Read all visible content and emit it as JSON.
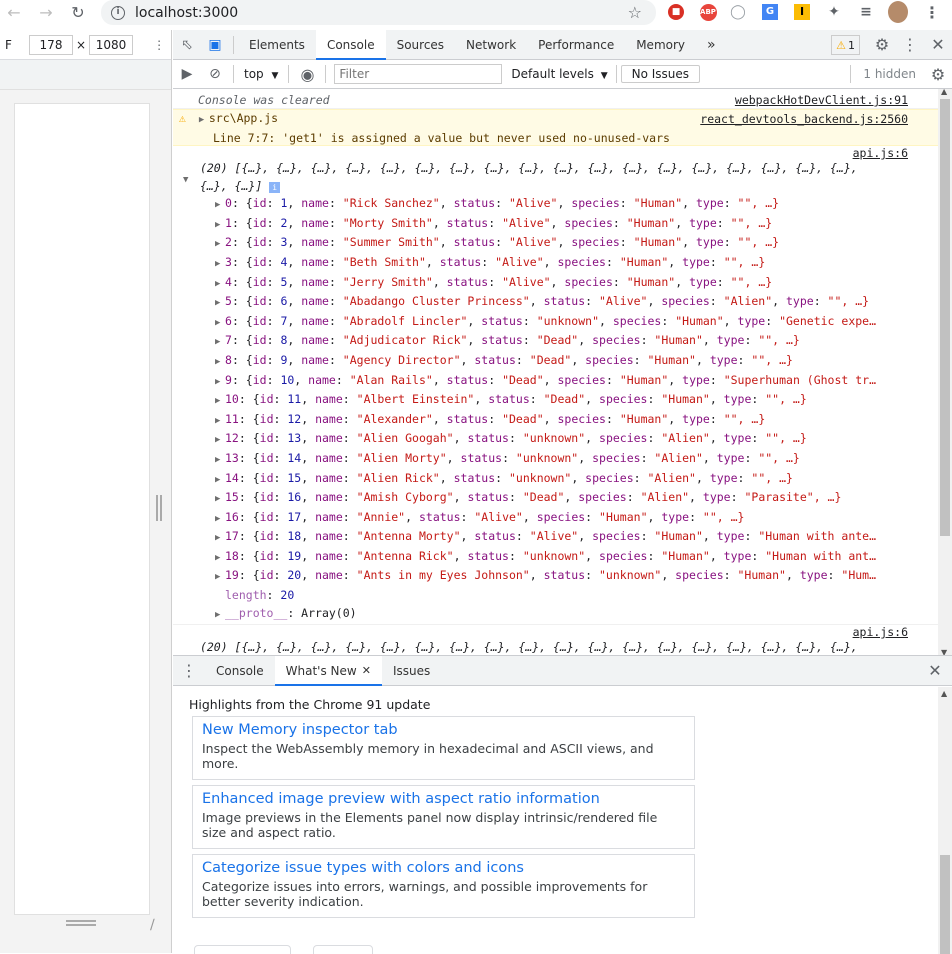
{
  "browser": {
    "url": "localhost:3000"
  },
  "device_toolbar": {
    "label": "F",
    "width": "178",
    "times": "×",
    "height": "1080"
  },
  "devtools": {
    "tabs": [
      "Elements",
      "Console",
      "Sources",
      "Network",
      "Performance",
      "Memory"
    ],
    "more": "»",
    "warn_count": "1",
    "console_toolbar": {
      "context": "top",
      "filter_placeholder": "Filter",
      "levels": "Default levels",
      "issues": "No Issues",
      "hidden": "1 hidden"
    },
    "console": {
      "cleared": "Console was cleared",
      "cleared_src": "webpackHotDevClient.js:91",
      "warning_file": "src\\App.js",
      "warning_src": "react_devtools_backend.js:2560",
      "warning_msg": "Line 7:7:  'get1' is assigned a value but never used  no-unused-vars",
      "api_src": "api.js:6",
      "array_header_1": "(20) [{…}, {…}, {…}, {…}, {…}, {…}, {…}, {…}, {…}, {…}, {…}, {…}, {…}, {…}, {…}, {…}, {…}, {…},",
      "array_header_2": "{…}, {…}]",
      "items": [
        {
          "idx": "0",
          "id": "1",
          "name": "\"Rick Sanchez\"",
          "status": "\"Alive\"",
          "species": "\"Human\"",
          "type": "\"\", …}"
        },
        {
          "idx": "1",
          "id": "2",
          "name": "\"Morty Smith\"",
          "status": "\"Alive\"",
          "species": "\"Human\"",
          "type": "\"\", …}"
        },
        {
          "idx": "2",
          "id": "3",
          "name": "\"Summer Smith\"",
          "status": "\"Alive\"",
          "species": "\"Human\"",
          "type": "\"\", …}"
        },
        {
          "idx": "3",
          "id": "4",
          "name": "\"Beth Smith\"",
          "status": "\"Alive\"",
          "species": "\"Human\"",
          "type": "\"\", …}"
        },
        {
          "idx": "4",
          "id": "5",
          "name": "\"Jerry Smith\"",
          "status": "\"Alive\"",
          "species": "\"Human\"",
          "type": "\"\", …}"
        },
        {
          "idx": "5",
          "id": "6",
          "name": "\"Abadango Cluster Princess\"",
          "status": "\"Alive\"",
          "species": "\"Alien\"",
          "type": "\"\", …}"
        },
        {
          "idx": "6",
          "id": "7",
          "name": "\"Abradolf Lincler\"",
          "status": "\"unknown\"",
          "species": "\"Human\"",
          "type": "\"Genetic expe…"
        },
        {
          "idx": "7",
          "id": "8",
          "name": "\"Adjudicator Rick\"",
          "status": "\"Dead\"",
          "species": "\"Human\"",
          "type": "\"\", …}"
        },
        {
          "idx": "8",
          "id": "9",
          "name": "\"Agency Director\"",
          "status": "\"Dead\"",
          "species": "\"Human\"",
          "type": "\"\", …}"
        },
        {
          "idx": "9",
          "id": "10",
          "name": "\"Alan Rails\"",
          "status": "\"Dead\"",
          "species": "\"Human\"",
          "type": "\"Superhuman (Ghost tr…"
        },
        {
          "idx": "10",
          "id": "11",
          "name": "\"Albert Einstein\"",
          "status": "\"Dead\"",
          "species": "\"Human\"",
          "type": "\"\", …}"
        },
        {
          "idx": "11",
          "id": "12",
          "name": "\"Alexander\"",
          "status": "\"Dead\"",
          "species": "\"Human\"",
          "type": "\"\", …}"
        },
        {
          "idx": "12",
          "id": "13",
          "name": "\"Alien Googah\"",
          "status": "\"unknown\"",
          "species": "\"Alien\"",
          "type": "\"\", …}"
        },
        {
          "idx": "13",
          "id": "14",
          "name": "\"Alien Morty\"",
          "status": "\"unknown\"",
          "species": "\"Alien\"",
          "type": "\"\", …}"
        },
        {
          "idx": "14",
          "id": "15",
          "name": "\"Alien Rick\"",
          "status": "\"unknown\"",
          "species": "\"Alien\"",
          "type": "\"\", …}"
        },
        {
          "idx": "15",
          "id": "16",
          "name": "\"Amish Cyborg\"",
          "status": "\"Dead\"",
          "species": "\"Alien\"",
          "type": "\"Parasite\", …}"
        },
        {
          "idx": "16",
          "id": "17",
          "name": "\"Annie\"",
          "status": "\"Alive\"",
          "species": "\"Human\"",
          "type": "\"\", …}"
        },
        {
          "idx": "17",
          "id": "18",
          "name": "\"Antenna Morty\"",
          "status": "\"Alive\"",
          "species": "\"Human\"",
          "type": "\"Human with ante…"
        },
        {
          "idx": "18",
          "id": "19",
          "name": "\"Antenna Rick\"",
          "status": "\"unknown\"",
          "species": "\"Human\"",
          "type": "\"Human with ant…"
        },
        {
          "idx": "19",
          "id": "20",
          "name": "\"Ants in my Eyes Johnson\"",
          "status": "\"unknown\"",
          "species": "\"Human\"",
          "type": "\"Hum…"
        }
      ],
      "length_label": "length",
      "length_value": "20",
      "proto_label": "__proto__",
      "proto_value": "Array(0)"
    },
    "drawer": {
      "tabs": [
        "Console",
        "What's New",
        "Issues"
      ],
      "highlights": "Highlights from the Chrome 91 update",
      "cards": [
        {
          "title": "New Memory inspector tab",
          "desc": "Inspect the WebAssembly memory in hexadecimal and ASCII views, and more."
        },
        {
          "title": "Enhanced image preview with aspect ratio information",
          "desc": "Image previews in the Elements panel now display intrinsic/rendered file size and aspect ratio."
        },
        {
          "title": "Categorize issue types with colors and icons",
          "desc": "Categorize issues into errors, warnings, and possible improvements for better severity indication."
        }
      ]
    }
  }
}
